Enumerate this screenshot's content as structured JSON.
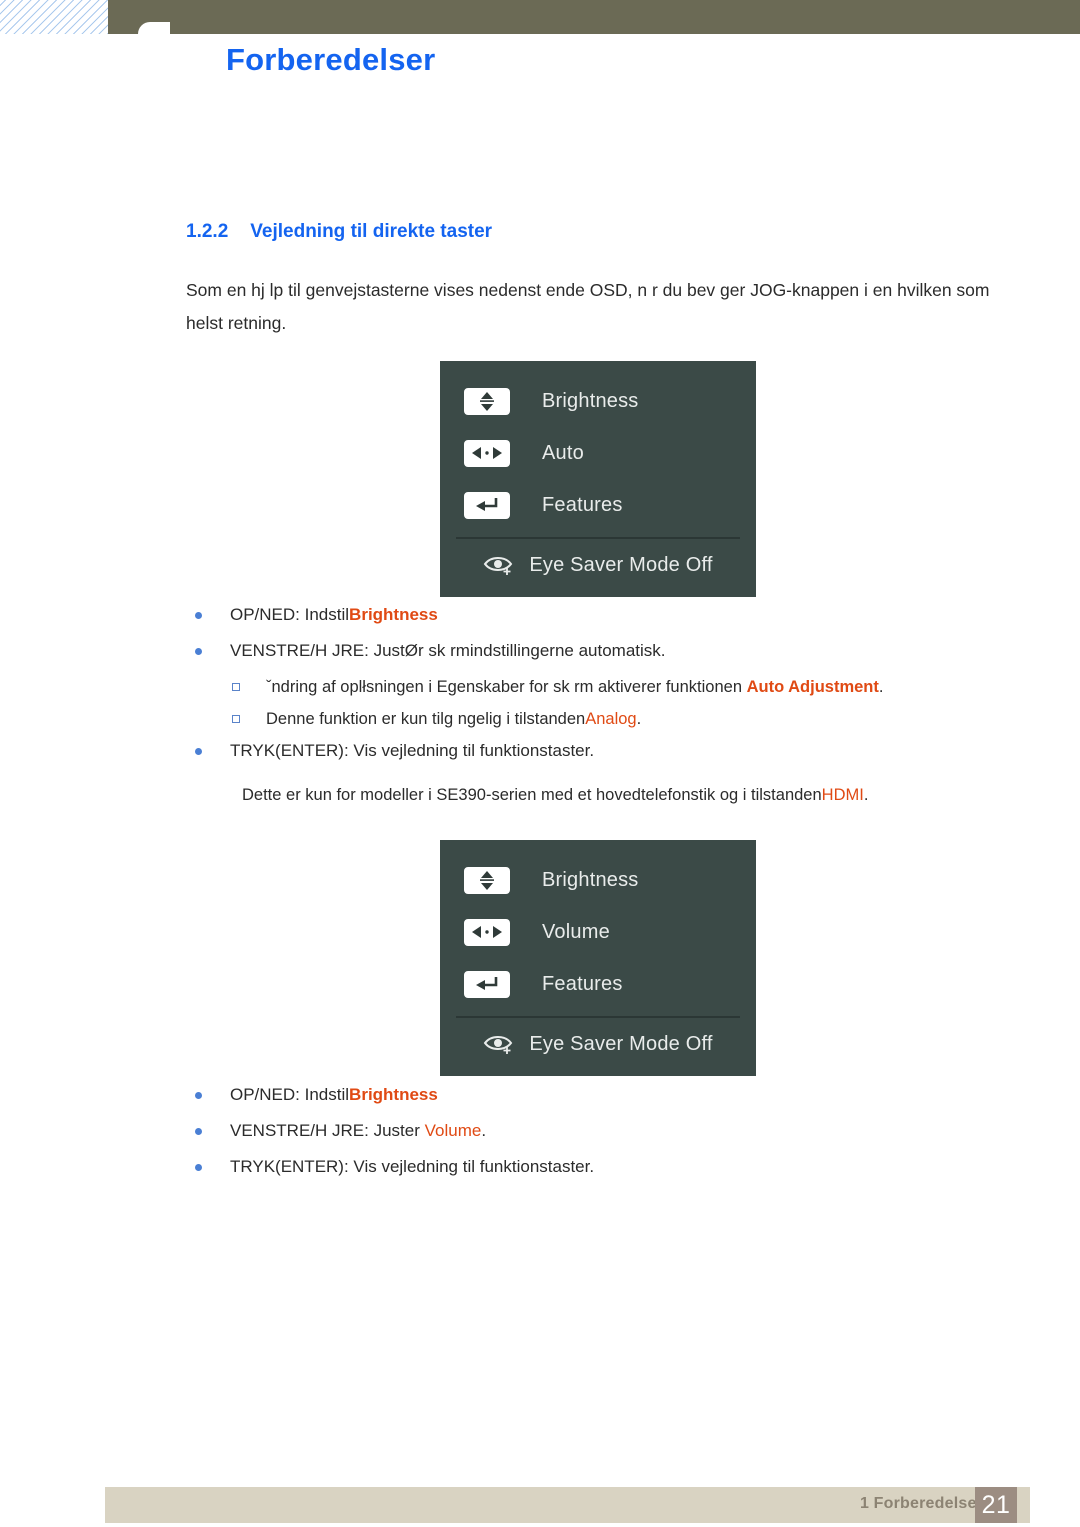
{
  "header": {
    "title": "Forberedelser",
    "title_color": "#1464f0",
    "bar_color": "#6b6a55"
  },
  "section": {
    "number": "1.2.2",
    "heading": "Vejledning til direkte taster",
    "intro": "Som en hj lp til genvejstasterne vises nedenst ende OSD, n r du bev ger JOG-knappen i en hvilken som helst retning."
  },
  "osd_menus": [
    {
      "rows": [
        {
          "icon": "updown-key-icon",
          "label": "Brightness"
        },
        {
          "icon": "leftright-key-icon",
          "label": "Auto"
        },
        {
          "icon": "enter-key-icon",
          "label": "Features"
        }
      ],
      "footer": {
        "icon": "eye-saver-icon",
        "label": "Eye Saver Mode Off"
      }
    },
    {
      "rows": [
        {
          "icon": "updown-key-icon",
          "label": "Brightness"
        },
        {
          "icon": "leftright-key-icon",
          "label": "Volume"
        },
        {
          "icon": "enter-key-icon",
          "label": "Features"
        }
      ],
      "footer": {
        "icon": "eye-saver-icon",
        "label": "Eye Saver Mode Off"
      }
    }
  ],
  "list_one": {
    "bullets": [
      {
        "text": "OP/NED: Indstil",
        "highlight": "Brightness",
        "tail": ""
      },
      {
        "text": "VENSTRE/H JRE: JustØr sk rmindstillingerne automatisk.",
        "highlight": "",
        "tail": ""
      },
      {
        "text": "TRYK(ENTER): Vis vejledning til funktionstaster.",
        "highlight": "",
        "tail": ""
      }
    ],
    "subs": [
      {
        "text": "ˇndring af oplłsningen i Egenskaber for sk rm aktiverer funktionen ",
        "highlight": "Auto Adjustment",
        "tail": "."
      },
      {
        "text": "Denne funktion er kun tilg ngelig i tilstanden",
        "highlight": "Analog",
        "tail": "."
      }
    ],
    "note": {
      "text": "Dette er kun for modeller i SE390-serien med et hovedtelefonstik og i tilstanden",
      "highlight": "HDMI",
      "tail": "."
    }
  },
  "list_two": {
    "bullets": [
      {
        "text": "OP/NED: Indstil",
        "highlight": "Brightness",
        "tail": ""
      },
      {
        "text": "VENSTRE/H JRE: Juster ",
        "highlight": "Volume",
        "tail": "."
      },
      {
        "text": "TRYK(ENTER): Vis vejledning til funktionstaster.",
        "highlight": "",
        "tail": ""
      }
    ]
  },
  "footer": {
    "chapter": "1 Forberedelser",
    "page_number": "21",
    "bar_color": "#d9d3c2",
    "page_box_color": "#9c8d82"
  }
}
